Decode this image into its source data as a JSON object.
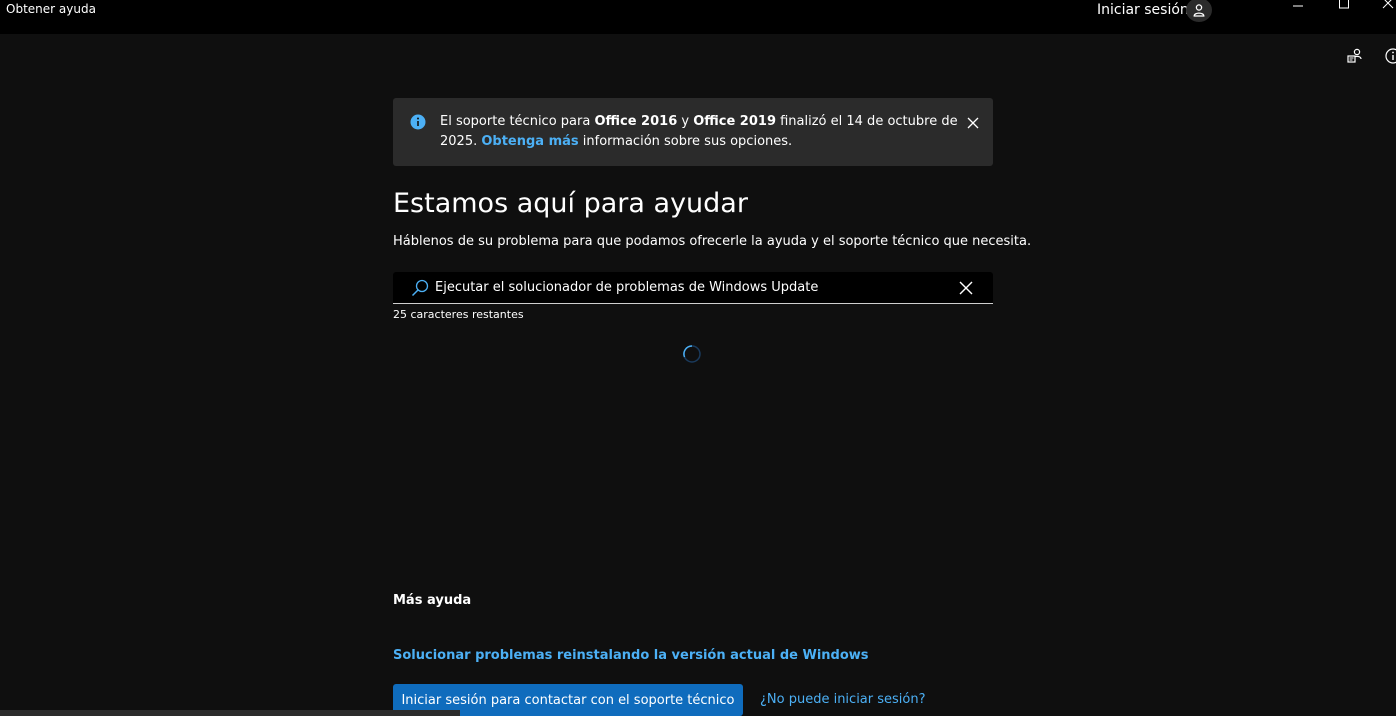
{
  "window": {
    "title": "Obtener ayuda",
    "signin_label": "Iniciar sesión"
  },
  "notice": {
    "text_1": "El soporte técnico para ",
    "product_1": "Office 2016",
    "text_2": " y ",
    "product_2": "Office 2019",
    "text_3": " finalizó el 14 de octubre de 2025. ",
    "link": "Obtenga más",
    "text_4": " información sobre sus opciones."
  },
  "main": {
    "title": "Estamos aquí para ayudar",
    "subtitle": "Háblenos de su problema para que podamos ofrecerle la ayuda y el soporte técnico que necesita."
  },
  "search": {
    "value": "Ejecutar el solucionador de problemas de Windows Update",
    "chars_remaining": "25 caracteres restantes"
  },
  "more_help": {
    "heading": "Más ayuda",
    "reinstall_link": "Solucionar problemas reinstalando la versión actual de Windows",
    "contact_button": "Iniciar sesión para contactar con el soporte técnico",
    "cant_signin_link": "¿No puede iniciar sesión?"
  },
  "colors": {
    "background": "#0f0f0f",
    "titlebar": "#000000",
    "banner": "#2b2b2b",
    "accent": "#4cb0f5",
    "button": "#0f6cbd"
  },
  "icons": {
    "account": "person-icon",
    "feedback": "feedback-icon",
    "info": "info-icon",
    "search": "search-icon",
    "close": "close-icon",
    "loading": "loading-spinner-icon"
  }
}
